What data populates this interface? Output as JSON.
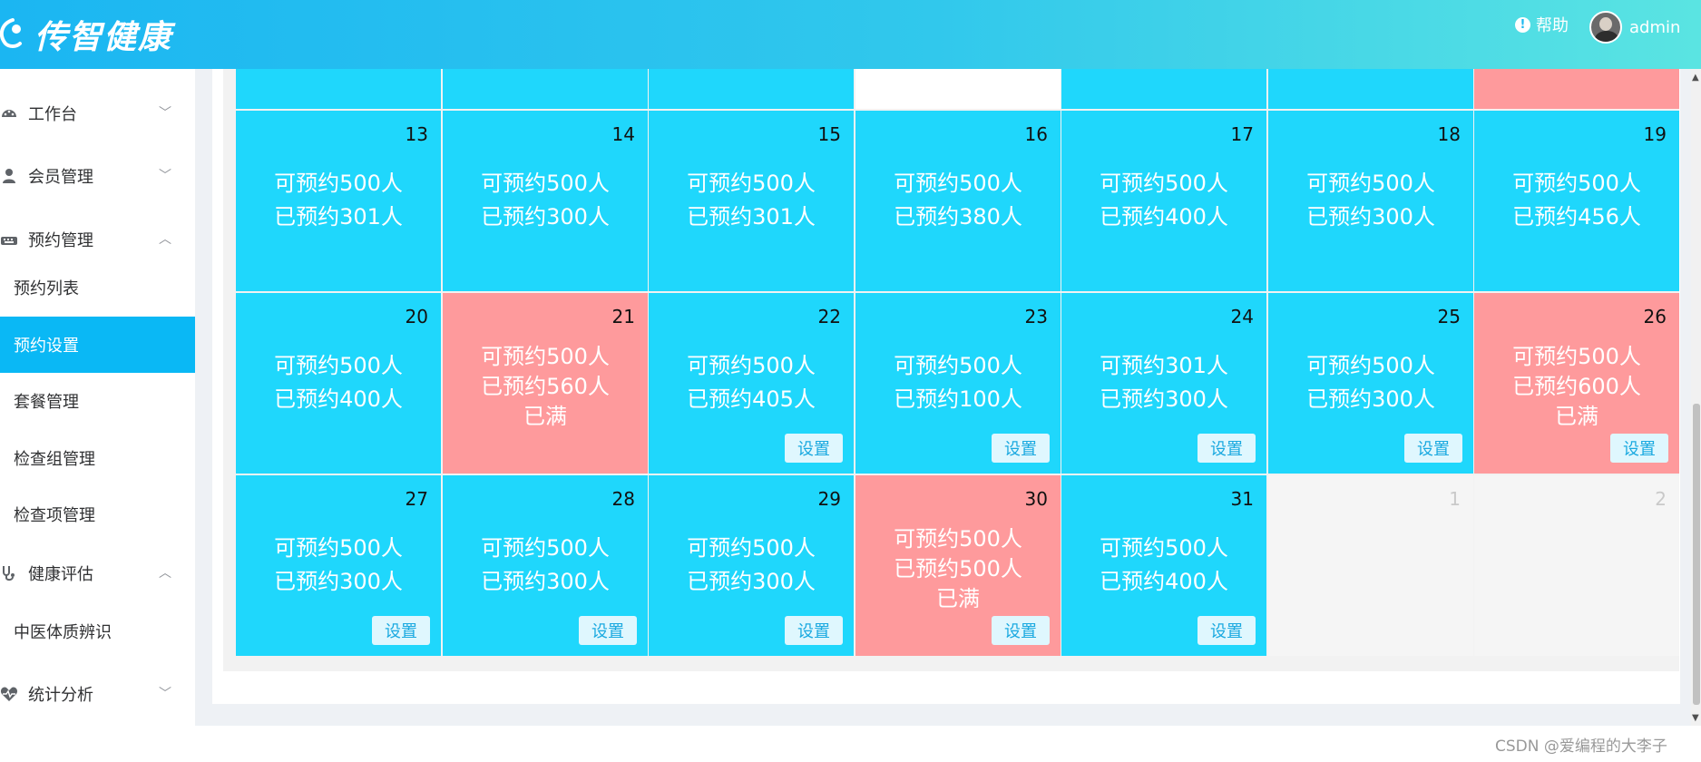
{
  "header": {
    "logo_text": "传智健康",
    "help_label": "帮助",
    "user_name": "admin"
  },
  "sidebar": {
    "menus": [
      {
        "label": "工作台",
        "icon": "dashboard-icon",
        "chevron": "down"
      },
      {
        "label": "会员管理",
        "icon": "user-icon",
        "chevron": "down"
      },
      {
        "label": "预约管理",
        "icon": "keyboard-icon",
        "chevron": "up"
      },
      {
        "label": "健康评估",
        "icon": "stethoscope-icon",
        "chevron": "up"
      },
      {
        "label": "统计分析",
        "icon": "heartbeat-icon",
        "chevron": "down"
      }
    ],
    "subitems": [
      {
        "label": "预约列表",
        "active": false
      },
      {
        "label": "预约设置",
        "active": true
      },
      {
        "label": "套餐管理",
        "active": false
      },
      {
        "label": "检查组管理",
        "active": false
      },
      {
        "label": "检查项管理",
        "active": false
      },
      {
        "label": "中医体质辨识",
        "active": false
      }
    ]
  },
  "calendar": {
    "set_label": "设置",
    "full_label": "已满",
    "rows": [
      [
        {
          "type": "available"
        },
        {
          "type": "available"
        },
        {
          "type": "available"
        },
        {
          "type": "empty"
        },
        {
          "type": "available"
        },
        {
          "type": "available"
        },
        {
          "type": "full"
        }
      ],
      [
        {
          "day": "13",
          "line1": "可预约500人",
          "line2": "已预约301人",
          "type": "available",
          "btn": false
        },
        {
          "day": "14",
          "line1": "可预约500人",
          "line2": "已预约300人",
          "type": "available",
          "btn": false
        },
        {
          "day": "15",
          "line1": "可预约500人",
          "line2": "已预约301人",
          "type": "available",
          "btn": false
        },
        {
          "day": "16",
          "line1": "可预约500人",
          "line2": "已预约380人",
          "type": "available",
          "btn": false
        },
        {
          "day": "17",
          "line1": "可预约500人",
          "line2": "已预约400人",
          "type": "available",
          "btn": false
        },
        {
          "day": "18",
          "line1": "可预约500人",
          "line2": "已预约300人",
          "type": "available",
          "btn": false
        },
        {
          "day": "19",
          "line1": "可预约500人",
          "line2": "已预约456人",
          "type": "available",
          "btn": false
        }
      ],
      [
        {
          "day": "20",
          "line1": "可预约500人",
          "line2": "已预约400人",
          "type": "available",
          "btn": false
        },
        {
          "day": "21",
          "line1": "可预约500人",
          "line2": "已预约560人",
          "type": "full",
          "btn": false
        },
        {
          "day": "22",
          "line1": "可预约500人",
          "line2": "已预约405人",
          "type": "available",
          "btn": true
        },
        {
          "day": "23",
          "line1": "可预约500人",
          "line2": "已预约100人",
          "type": "available",
          "btn": true
        },
        {
          "day": "24",
          "line1": "可预约301人",
          "line2": "已预约300人",
          "type": "available",
          "btn": true
        },
        {
          "day": "25",
          "line1": "可预约500人",
          "line2": "已预约300人",
          "type": "available",
          "btn": true
        },
        {
          "day": "26",
          "line1": "可预约500人",
          "line2": "已预约600人",
          "type": "full",
          "btn": true
        }
      ],
      [
        {
          "day": "27",
          "line1": "可预约500人",
          "line2": "已预约300人",
          "type": "available",
          "btn": true
        },
        {
          "day": "28",
          "line1": "可预约500人",
          "line2": "已预约300人",
          "type": "available",
          "btn": true
        },
        {
          "day": "29",
          "line1": "可预约500人",
          "line2": "已预约300人",
          "type": "available",
          "btn": true
        },
        {
          "day": "30",
          "line1": "可预约500人",
          "line2": "已预约500人",
          "type": "full",
          "btn": true
        },
        {
          "day": "31",
          "line1": "可预约500人",
          "line2": "已预约400人",
          "type": "available",
          "btn": true
        },
        {
          "day": "1",
          "type": "other"
        },
        {
          "day": "2",
          "type": "other"
        }
      ]
    ]
  },
  "watermark": "CSDN @爱编程的大李子",
  "colors": {
    "available": "#1fd7fc",
    "full": "#fe9a9c",
    "active_menu": "#0ab8f5"
  }
}
